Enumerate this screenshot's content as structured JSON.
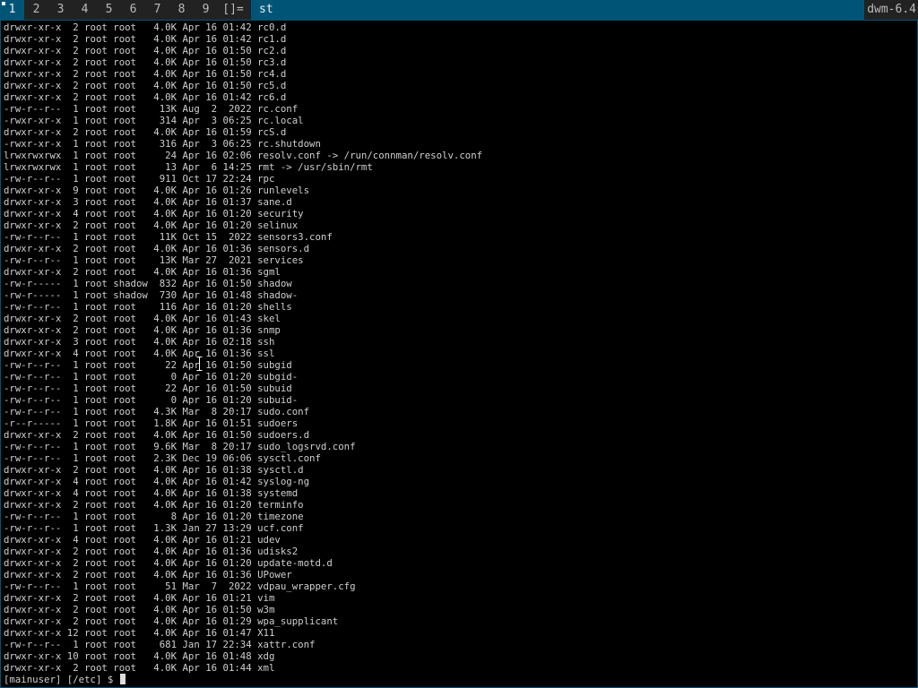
{
  "bar": {
    "tags": [
      "1",
      "2",
      "3",
      "4",
      "5",
      "6",
      "7",
      "8",
      "9"
    ],
    "selected_tag": 0,
    "layout_symbol": "[]=",
    "window_title": "st",
    "status": "dwm-6.4"
  },
  "terminal": {
    "lines": [
      "drwxr-xr-x  2 root root   4.0K Apr 16 01:42 rc0.d",
      "drwxr-xr-x  2 root root   4.0K Apr 16 01:42 rc1.d",
      "drwxr-xr-x  2 root root   4.0K Apr 16 01:50 rc2.d",
      "drwxr-xr-x  2 root root   4.0K Apr 16 01:50 rc3.d",
      "drwxr-xr-x  2 root root   4.0K Apr 16 01:50 rc4.d",
      "drwxr-xr-x  2 root root   4.0K Apr 16 01:50 rc5.d",
      "drwxr-xr-x  2 root root   4.0K Apr 16 01:42 rc6.d",
      "-rw-r--r--  1 root root    13K Aug  2  2022 rc.conf",
      "-rwxr-xr-x  1 root root    314 Apr  3 06:25 rc.local",
      "drwxr-xr-x  2 root root   4.0K Apr 16 01:59 rcS.d",
      "-rwxr-xr-x  1 root root    316 Apr  3 06:25 rc.shutdown",
      "lrwxrwxrwx  1 root root     24 Apr 16 02:06 resolv.conf -> /run/connman/resolv.conf",
      "lrwxrwxrwx  1 root root     13 Apr  6 14:25 rmt -> /usr/sbin/rmt",
      "-rw-r--r--  1 root root    911 Oct 17 22:24 rpc",
      "drwxr-xr-x  9 root root   4.0K Apr 16 01:26 runlevels",
      "drwxr-xr-x  3 root root   4.0K Apr 16 01:37 sane.d",
      "drwxr-xr-x  4 root root   4.0K Apr 16 01:20 security",
      "drwxr-xr-x  2 root root   4.0K Apr 16 01:20 selinux",
      "-rw-r--r--  1 root root    11K Oct 15  2022 sensors3.conf",
      "drwxr-xr-x  2 root root   4.0K Apr 16 01:36 sensors.d",
      "-rw-r--r--  1 root root    13K Mar 27  2021 services",
      "drwxr-xr-x  2 root root   4.0K Apr 16 01:36 sgml",
      "-rw-r-----  1 root shadow  832 Apr 16 01:50 shadow",
      "-rw-r-----  1 root shadow  730 Apr 16 01:48 shadow-",
      "-rw-r--r--  1 root root    116 Apr 16 01:20 shells",
      "drwxr-xr-x  2 root root   4.0K Apr 16 01:43 skel",
      "drwxr-xr-x  2 root root   4.0K Apr 16 01:36 snmp",
      "drwxr-xr-x  3 root root   4.0K Apr 16 02:18 ssh",
      "drwxr-xr-x  4 root root   4.0K Apr 16 01:36 ssl",
      "-rw-r--r--  1 root root     22 Apr 16 01:50 subgid",
      "-rw-r--r--  1 root root      0 Apr 16 01:20 subgid-",
      "-rw-r--r--  1 root root     22 Apr 16 01:50 subuid",
      "-rw-r--r--  1 root root      0 Apr 16 01:20 subuid-",
      "-rw-r--r--  1 root root   4.3K Mar  8 20:17 sudo.conf",
      "-r--r-----  1 root root   1.8K Apr 16 01:51 sudoers",
      "drwxr-xr-x  2 root root   4.0K Apr 16 01:50 sudoers.d",
      "-rw-r--r--  1 root root   9.6K Mar  8 20:17 sudo_logsrvd.conf",
      "-rw-r--r--  1 root root   2.3K Dec 19 06:06 sysctl.conf",
      "drwxr-xr-x  2 root root   4.0K Apr 16 01:38 sysctl.d",
      "drwxr-xr-x  4 root root   4.0K Apr 16 01:42 syslog-ng",
      "drwxr-xr-x  4 root root   4.0K Apr 16 01:38 systemd",
      "drwxr-xr-x  2 root root   4.0K Apr 16 01:20 terminfo",
      "-rw-r--r--  1 root root      8 Apr 16 01:20 timezone",
      "-rw-r--r--  1 root root   1.3K Jan 27 13:29 ucf.conf",
      "drwxr-xr-x  4 root root   4.0K Apr 16 01:21 udev",
      "drwxr-xr-x  2 root root   4.0K Apr 16 01:36 udisks2",
      "drwxr-xr-x  2 root root   4.0K Apr 16 01:20 update-motd.d",
      "drwxr-xr-x  2 root root   4.0K Apr 16 01:36 UPower",
      "-rw-r--r--  1 root root     51 Mar  7  2022 vdpau_wrapper.cfg",
      "drwxr-xr-x  2 root root   4.0K Apr 16 01:21 vim",
      "drwxr-xr-x  2 root root   4.0K Apr 16 01:50 w3m",
      "drwxr-xr-x  2 root root   4.0K Apr 16 01:29 wpa_supplicant",
      "drwxr-xr-x 12 root root   4.0K Apr 16 01:47 X11",
      "-rw-r--r--  1 root root    681 Jan 17 22:34 xattr.conf",
      "drwxr-xr-x 10 root root   4.0K Apr 16 01:48 xdg",
      "drwxr-xr-x  2 root root   4.0K Apr 16 01:44 xml"
    ],
    "prompt": "[mainuser] [/etc] $ "
  },
  "colors": {
    "bar_bg": "#222222",
    "accent": "#005577",
    "bar_fg": "#bbbbbb",
    "selected_fg": "#eeeeee",
    "terminal_bg": "#000000",
    "terminal_fg": "#cfcfcf"
  },
  "icons": [
    "occupied-tag-indicator",
    "text-cursor-icon",
    "terminal-block-cursor"
  ]
}
